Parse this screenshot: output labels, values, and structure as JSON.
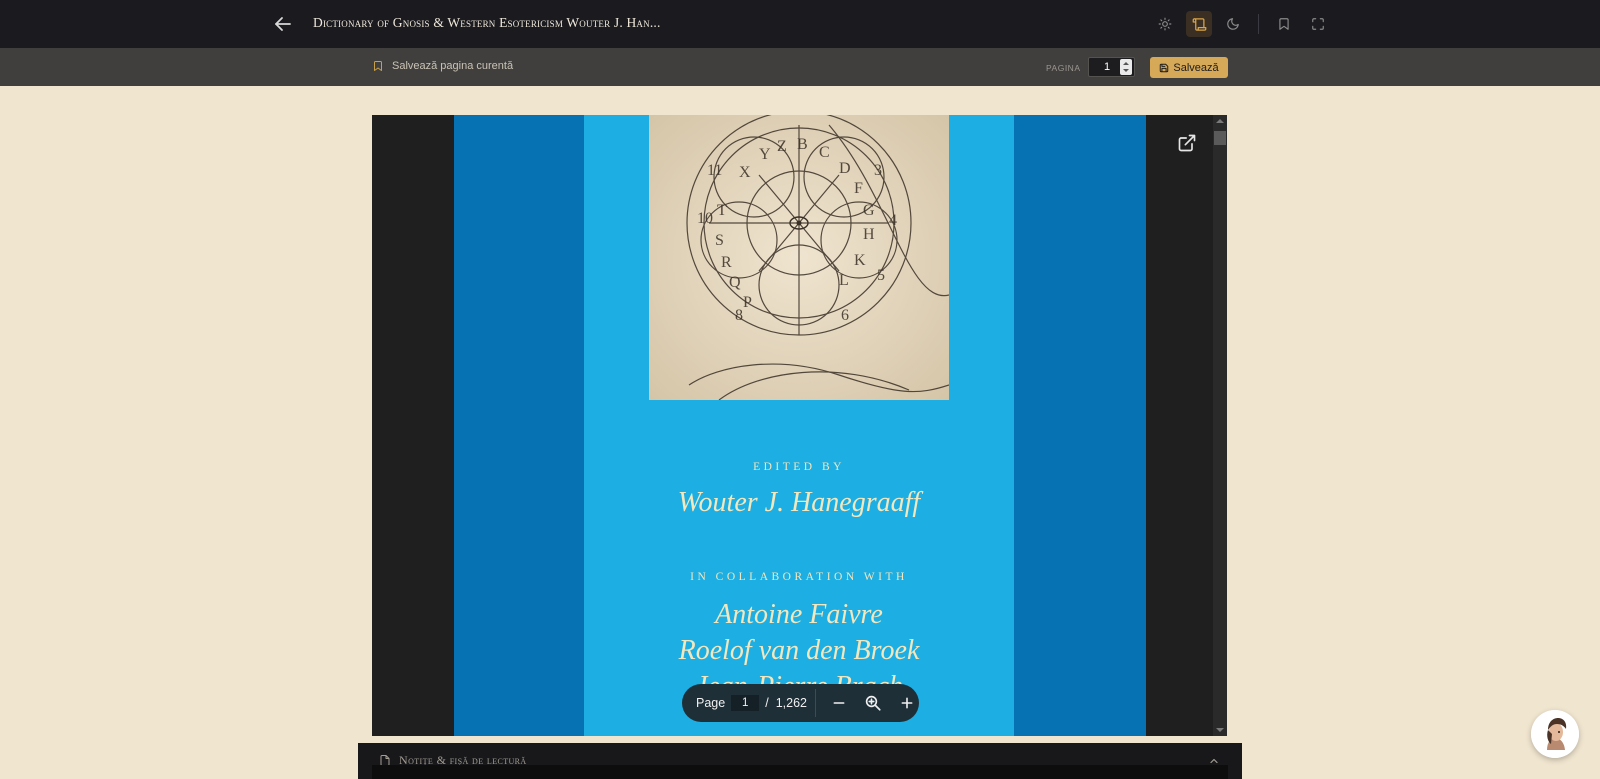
{
  "header": {
    "title": "Dictionary of Gnosis & Western Esotericism Wouter J. Han..."
  },
  "subbar": {
    "save_current_label": "Salvează pagina curentă",
    "page_label": "PAGINA",
    "page_value": "1",
    "save_label": "Salvează"
  },
  "cover": {
    "edited_by": "EDITED BY",
    "editor": "Wouter J. Hanegraaff",
    "collaboration": "IN COLLABORATION WITH",
    "collaborators": [
      "Antoine Faivre",
      "Roelof van den Broek",
      "Jean-Pierre Brach"
    ]
  },
  "pdf_toolbar": {
    "page_label": "Page",
    "current_page": "1",
    "separator": "/",
    "total_pages": "1,262"
  },
  "notes": {
    "title": "Notițe & fișă de lectură"
  },
  "colors": {
    "accent": "#d6a959",
    "topbar": "#1a1a1f",
    "background": "#f0e5cf",
    "cover_outer": "#0672b3",
    "cover_inner": "#1daee4"
  }
}
